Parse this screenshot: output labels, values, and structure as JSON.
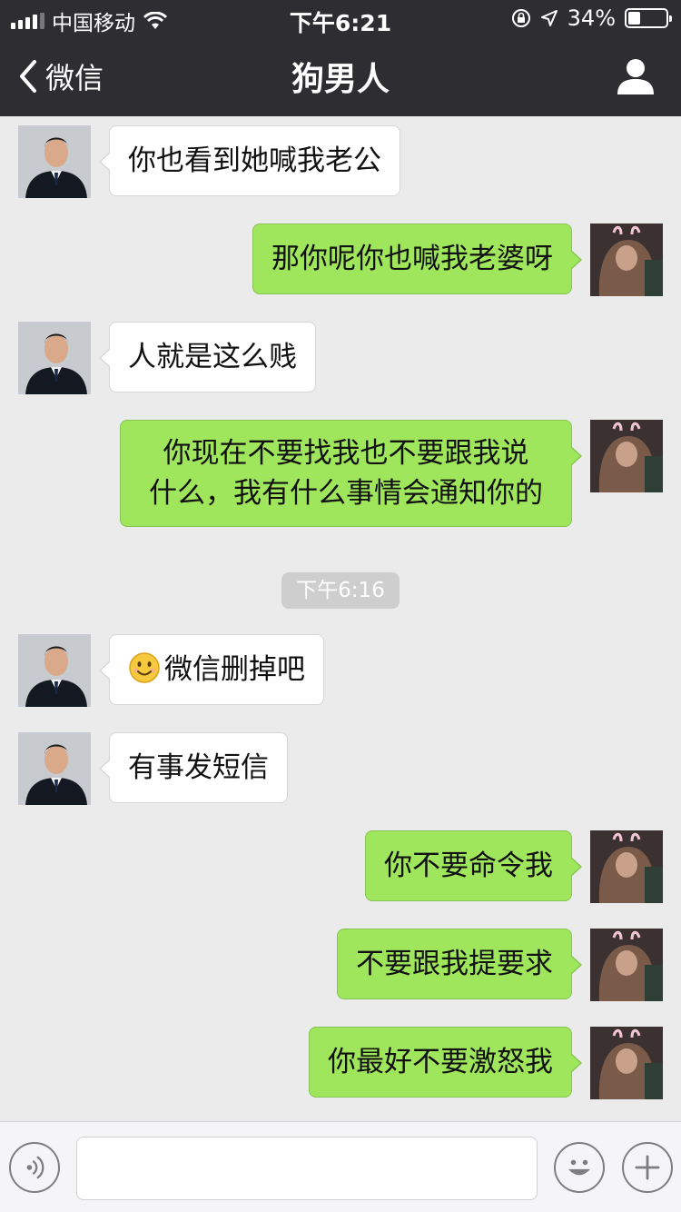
{
  "status_bar": {
    "carrier": "中国移动",
    "time": "下午6:21",
    "battery_percent": "34%",
    "battery_level": 0.34
  },
  "nav": {
    "back_label": "微信",
    "title": "狗男人"
  },
  "messages": [
    {
      "side": "left",
      "text": "你也看到她喊我老公"
    },
    {
      "side": "right",
      "text": "那你呢你也喊我老婆呀"
    },
    {
      "side": "left",
      "text": "人就是这么贱"
    },
    {
      "side": "right",
      "lines": [
        "你现在不要找我也不要跟我说",
        "什么，我有什么事情会通知你的"
      ]
    },
    {
      "type": "timestamp",
      "text": "下午6:16"
    },
    {
      "side": "left",
      "emoji": "smile-emoji",
      "text": "微信删掉吧"
    },
    {
      "side": "left",
      "text": "有事发短信"
    },
    {
      "side": "right",
      "text": "你不要命令我"
    },
    {
      "side": "right",
      "text": "不要跟我提要求"
    },
    {
      "side": "right",
      "text": "你最好不要激怒我"
    }
  ],
  "input_bar": {
    "text_value": "",
    "icons": [
      "voice-icon",
      "emoji-icon",
      "plus-icon"
    ]
  },
  "colors": {
    "header_bg": "#2e2e32",
    "chat_bg": "#ebebeb",
    "sent_bubble": "#9fe65d",
    "received_bubble": "#ffffff"
  }
}
